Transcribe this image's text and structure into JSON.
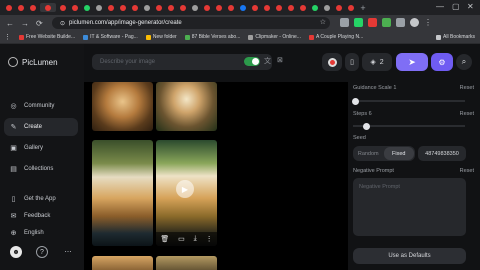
{
  "browser": {
    "tab_colors": [
      "#e53935",
      "#e53935",
      "#e53935",
      "#e53935",
      "#e53935",
      "#e53935",
      "#25d366",
      "#9e9e9e",
      "#e53935",
      "#e53935",
      "#e53935",
      "#9e9e9e",
      "#e53935",
      "#e53935",
      "#e53935",
      "#9e9e9e",
      "#e53935",
      "#e53935",
      "#e53935",
      "#1877f2",
      "#e53935",
      "#e53935",
      "#e53935",
      "#e53935",
      "#e53935",
      "#25d366",
      "#9e9e9e",
      "#e53935",
      "#e53935"
    ],
    "new_tab_label": "+",
    "url": "piclumen.com/app/image-generator/create",
    "bookmarks": [
      {
        "label": "Free Website Builde...",
        "color": "#e53935"
      },
      {
        "label": "IT & Software - Pag...",
        "color": "#3c8bd9"
      },
      {
        "label": "New folder",
        "color": "#fbbc04"
      },
      {
        "label": "87 Bible Verses abo...",
        "color": "#4caf50"
      },
      {
        "label": "Clipmaker - Online...",
        "color": "#9e9e9e"
      },
      {
        "label": "A Couple Playing N...",
        "color": "#e53935"
      }
    ],
    "all_bookmarks": "All Bookmarks"
  },
  "sidebar": {
    "brand": "PicLumen",
    "items": [
      {
        "label": "Community",
        "icon": "community-icon"
      },
      {
        "label": "Create",
        "icon": "create-icon",
        "active": true
      },
      {
        "label": "Gallery",
        "icon": "gallery-icon"
      },
      {
        "label": "Collections",
        "icon": "collections-icon"
      },
      {
        "label": "Get the App",
        "icon": "app-icon"
      },
      {
        "label": "Feedback",
        "icon": "feedback-icon"
      },
      {
        "label": "English",
        "icon": "globe-icon"
      }
    ]
  },
  "toolbar": {
    "prompt_placeholder": "Describe your image",
    "batch_count": "2",
    "accent": "#7f6ef5"
  },
  "settings": {
    "guidance_label": "Guidance Scale 1",
    "steps_label": "Steps 6",
    "reset_label": "Reset",
    "seed_label": "Seed",
    "seed_modes": [
      "Random",
      "Fixed"
    ],
    "seed_value": "48749838350",
    "negative_label": "Negative Prompt",
    "negative_placeholder": "Negative Prompt",
    "defaults_button": "Use as Defaults",
    "guidance_level": 0.0,
    "steps_level": 0.1
  }
}
